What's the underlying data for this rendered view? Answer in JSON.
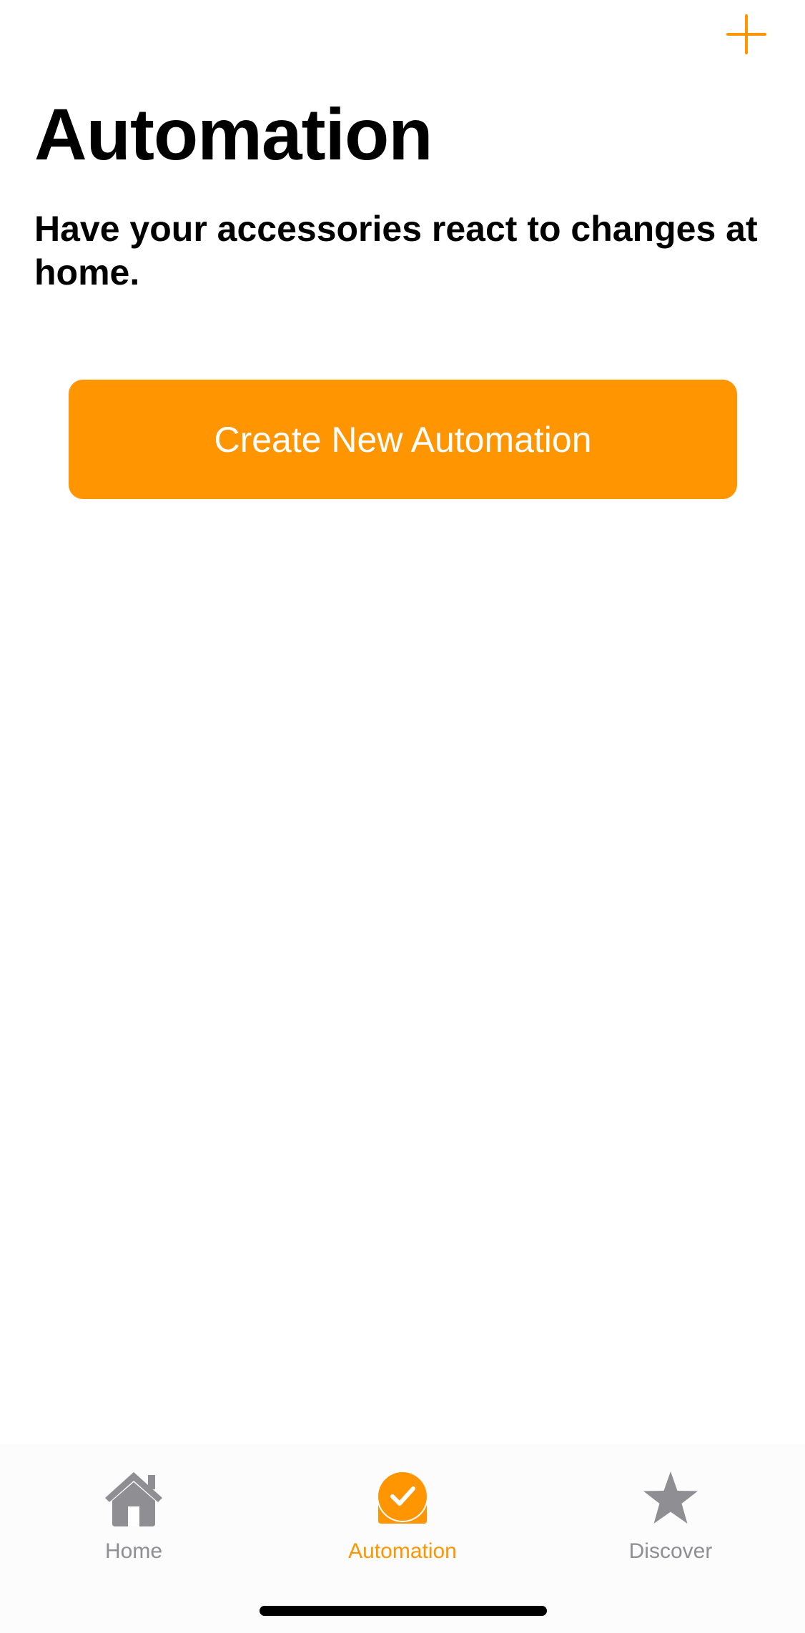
{
  "colors": {
    "accent": "#FF9500",
    "inactive": "#8E8E93",
    "text": "#000000",
    "background": "#FFFFFF"
  },
  "header": {
    "add_icon": "plus-icon"
  },
  "main": {
    "title": "Automation",
    "subtitle": "Have your accessories react to changes at home.",
    "create_button_label": "Create New Automation"
  },
  "tab_bar": {
    "selected": "Automation",
    "tabs": [
      {
        "label": "Home",
        "icon": "house-icon"
      },
      {
        "label": "Automation",
        "icon": "automation-check-icon"
      },
      {
        "label": "Discover",
        "icon": "star-icon"
      }
    ]
  }
}
